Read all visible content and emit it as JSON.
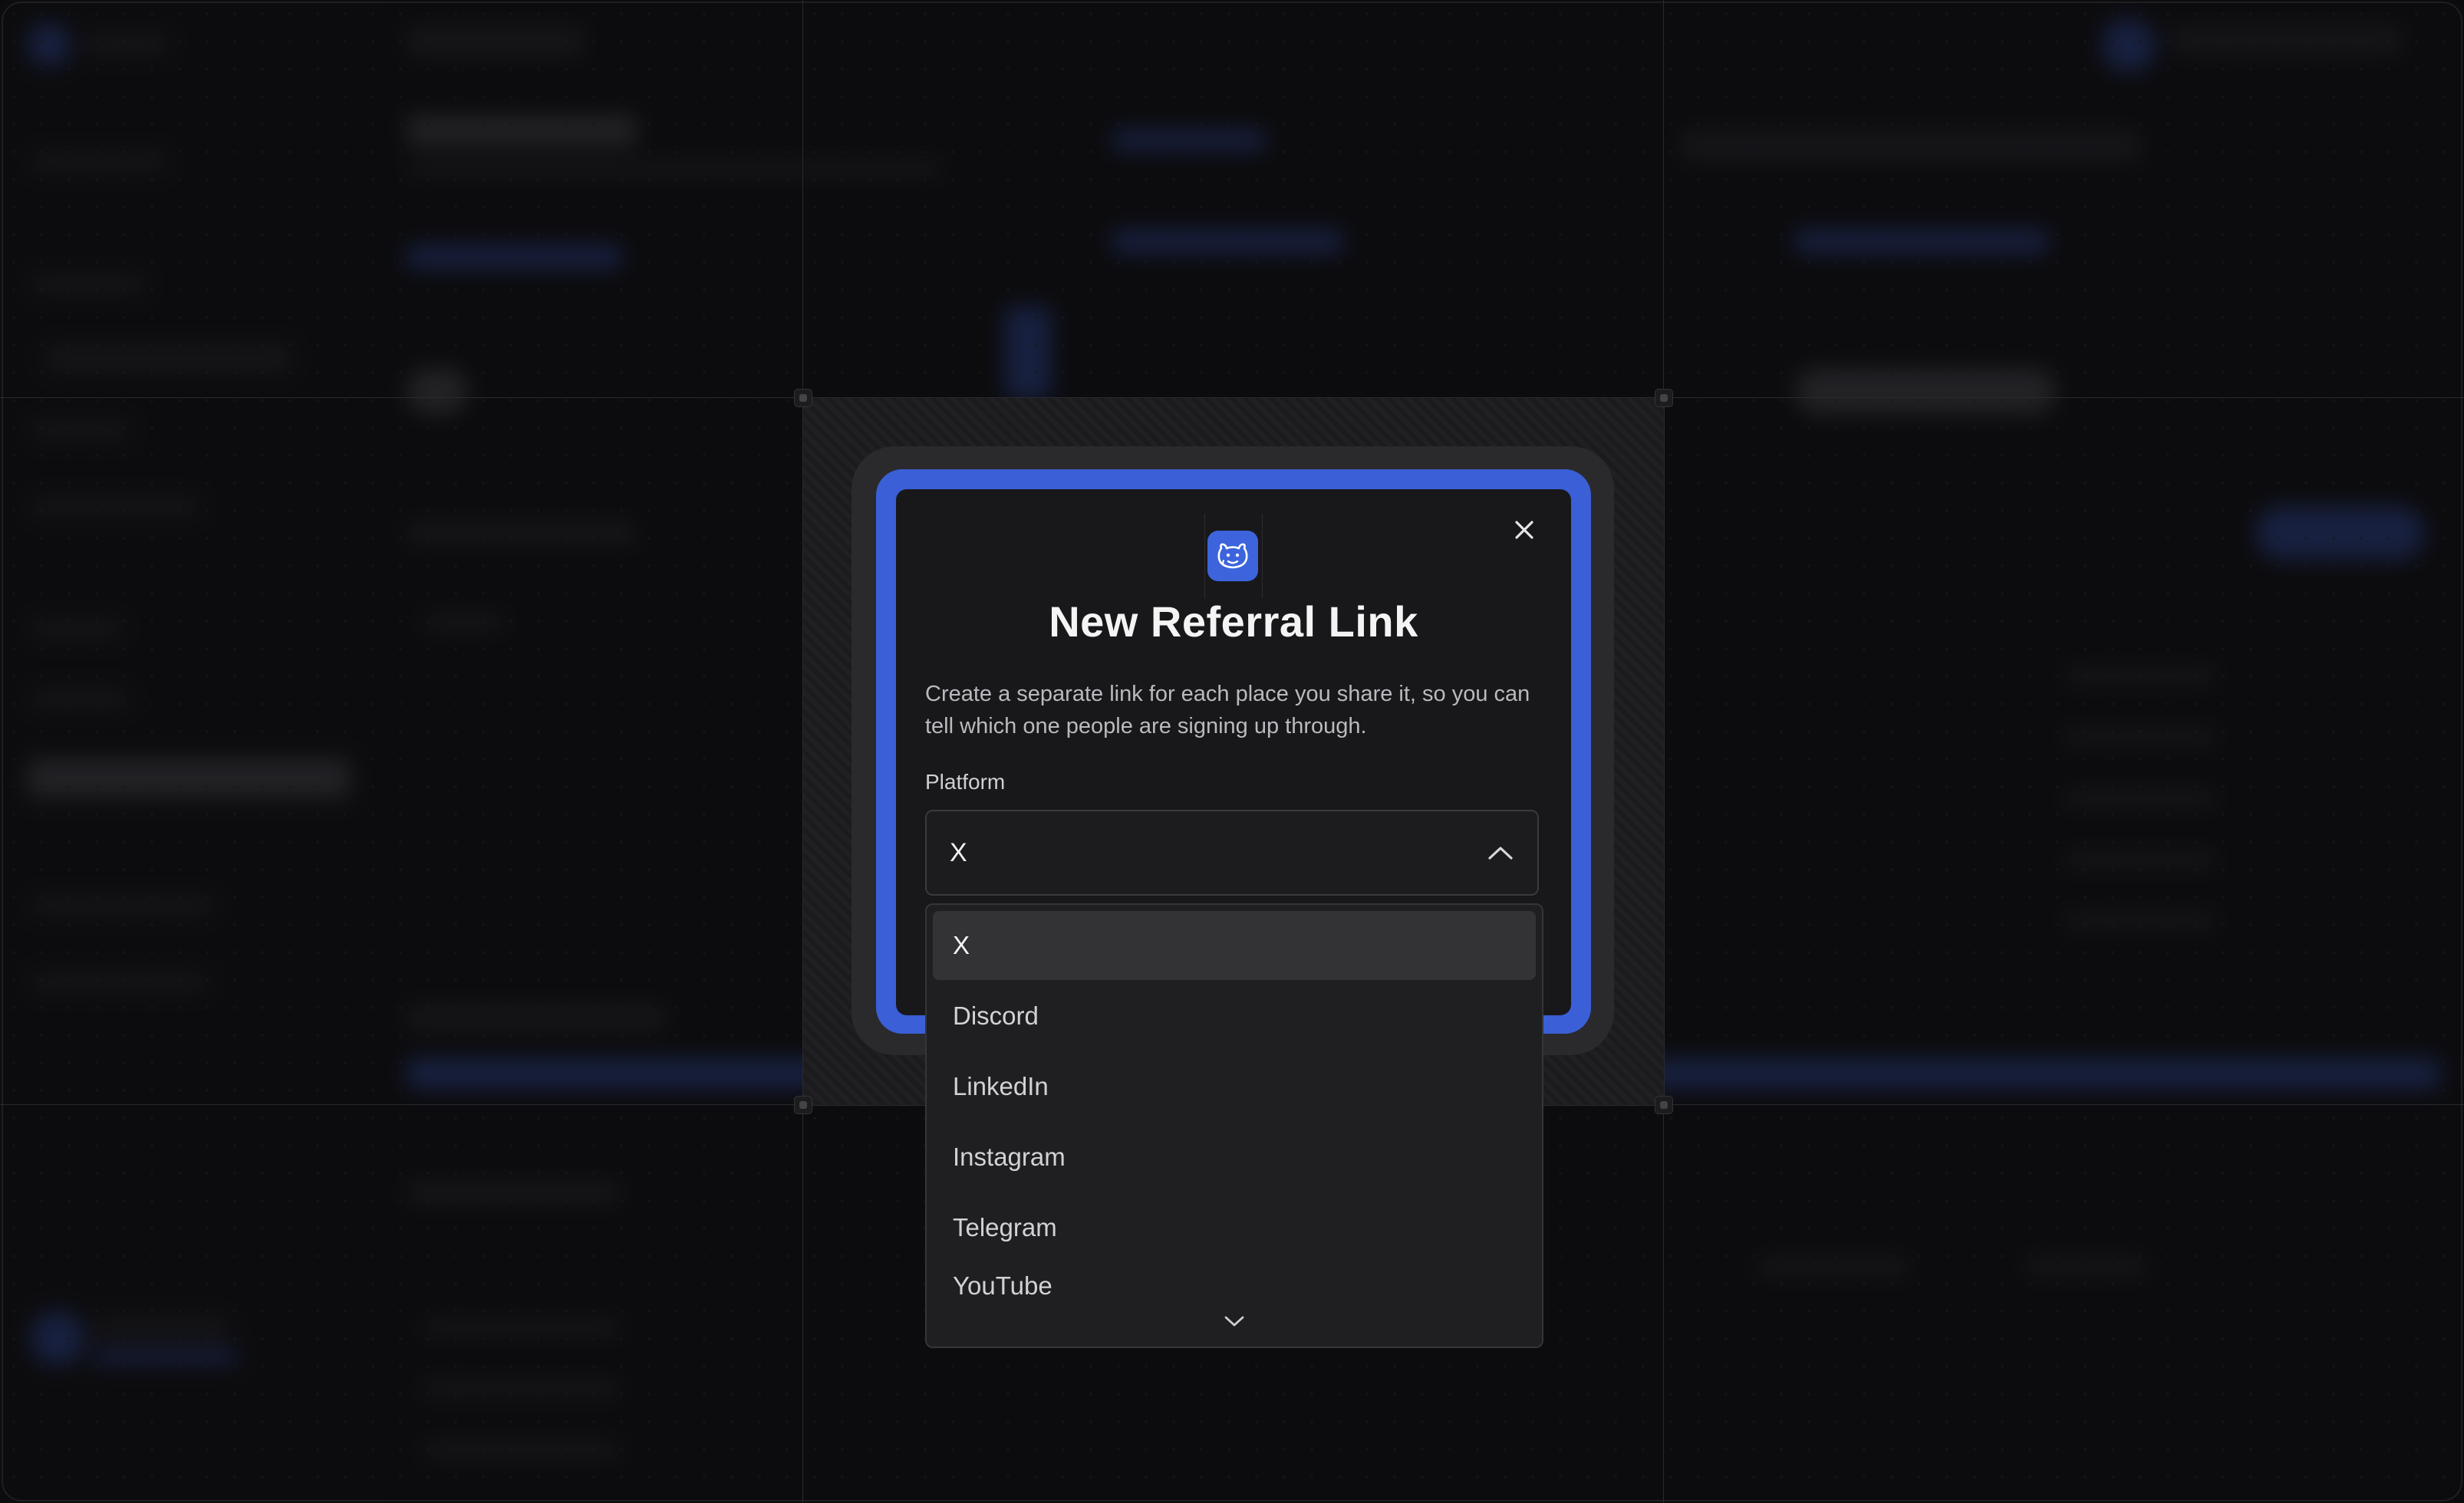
{
  "dialog": {
    "title": "New Referral Link",
    "description": "Create a separate link for each place you share it, so you can tell which one people are signing up through.",
    "close_icon": "close-icon",
    "logo_icon": "mascot-logo-icon",
    "platform_label": "Platform",
    "selected_value": "X",
    "options": [
      "X",
      "Discord",
      "LinkedIn",
      "Instagram",
      "Telegram",
      "YouTube"
    ],
    "selected_option": "X"
  },
  "colors": {
    "accent": "#3a5fd6",
    "dialog_bg": "#18181a",
    "dropdown_bg": "#1f1f21",
    "selected_row": "#333336"
  }
}
